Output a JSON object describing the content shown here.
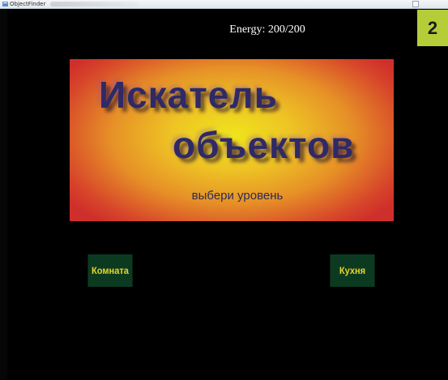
{
  "window": {
    "title": "ObjectFinder"
  },
  "hud": {
    "energy": "Energy: 200/200"
  },
  "badge": {
    "number": "2",
    "color": "#b4cd38"
  },
  "banner": {
    "title_line1": "Искатель",
    "title_line2": "объектов",
    "subtitle": "выбери уровень",
    "colors": {
      "center": "#f0e41c",
      "edge": "#cf2f2b",
      "text": "#2f2a66"
    }
  },
  "levels": [
    {
      "label": "Комната"
    },
    {
      "label": "Кухня"
    }
  ],
  "button_colors": {
    "background": "#0c3a20",
    "text": "#e6d52a"
  }
}
